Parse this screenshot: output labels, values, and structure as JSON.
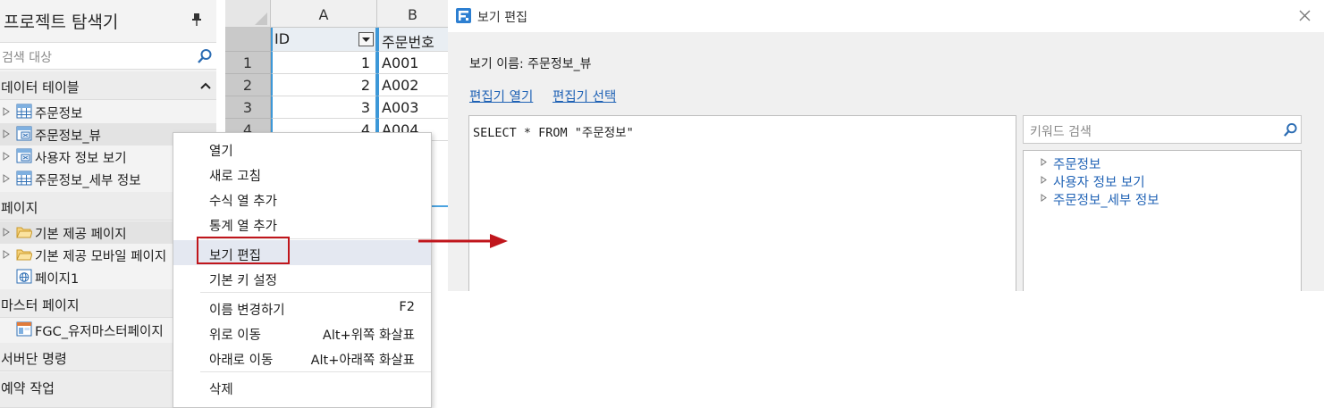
{
  "explorer": {
    "title": "프로젝트 탐색기",
    "search_placeholder": "검색 대상",
    "sections": {
      "data_tables": "데이터 테이블",
      "pages": "페이지",
      "master_pages": "마스터 페이지",
      "server_commands": "서버단 명령",
      "scheduled_tasks": "예약 작업"
    },
    "data_tables": [
      "주문정보",
      "주문정보_뷰",
      "사용자 정보 보기",
      "주문정보_세부 정보"
    ],
    "pages": [
      "기본 제공 페이지",
      "기본 제공 모바일 페이지",
      "페이지1"
    ],
    "master_pages": [
      "FGC_유저마스터페이지"
    ]
  },
  "sheet": {
    "columns": [
      "A",
      "B"
    ],
    "headers": [
      "ID",
      "주문번호"
    ],
    "rows": [
      {
        "num": "1",
        "id": "1",
        "order": "A001"
      },
      {
        "num": "2",
        "id": "2",
        "order": "A002"
      },
      {
        "num": "3",
        "id": "3",
        "order": "A003"
      },
      {
        "num": "4",
        "id": "4",
        "order": "A004"
      }
    ]
  },
  "context_menu": {
    "open": "열기",
    "refresh": "새로 고침",
    "add_formula_column": "수식 열 추가",
    "add_stat_column": "통계 열 추가",
    "edit_view": "보기 편집",
    "set_primary_key": "기본 키 설정",
    "rename": "이름 변경하기",
    "rename_key": "F2",
    "move_up": "위로 이동",
    "move_up_key": "Alt+위쪽 화살표",
    "move_down": "아래로 이동",
    "move_down_key": "Alt+아래쪽 화살표",
    "delete": "삭제"
  },
  "dialog": {
    "title": "보기 편집",
    "view_name_label": "보기 이름: 주문정보_뷰",
    "open_editor_link": "편집기 열기",
    "select_editor_link": "편집기 선택",
    "sql": "SELECT * FROM \"주문정보\"",
    "keyword_search_placeholder": "키워드 검색",
    "keyword_tree": [
      "주문정보",
      "사용자 정보 보기",
      "주문정보_세부 정보"
    ]
  },
  "colors": {
    "highlight_box": "#c0161c",
    "arrow": "#c0161c",
    "link": "#1f62b5",
    "selection": "#3d98d8"
  }
}
